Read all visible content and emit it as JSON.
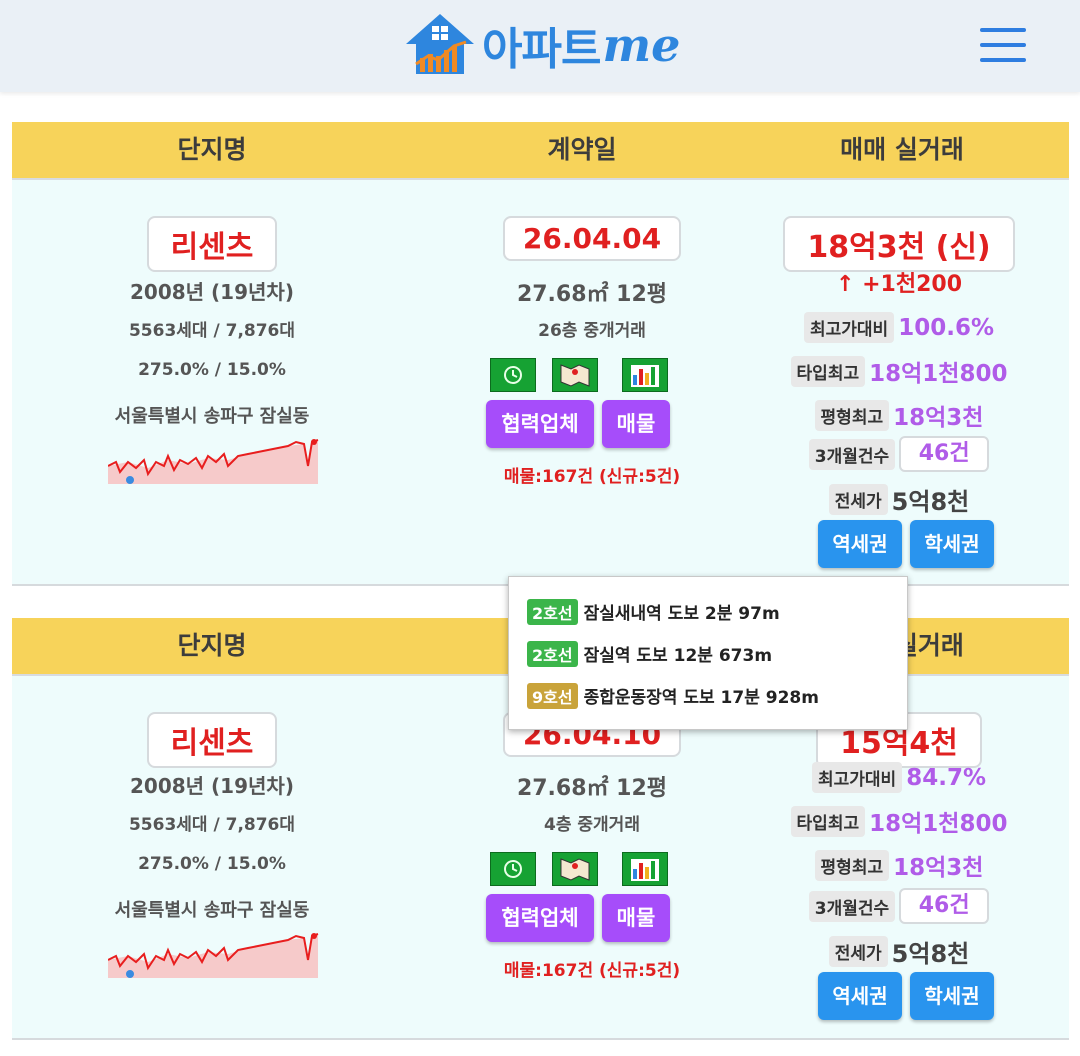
{
  "header": {
    "logo_text": "아파트",
    "logo_suffix": "me"
  },
  "columns": {
    "name": "단지명",
    "date": "계약일",
    "price": "매매 실거래"
  },
  "cards": [
    {
      "name": "리센츠",
      "year": "2008년 (19년차)",
      "households": "5563세대 / 7,876대",
      "ratio": "275.0% / 15.0%",
      "address": "서울특별시 송파구 잠실동",
      "date": "26.04.04",
      "area": "27.68㎡ 12평",
      "floor": "26층 중개거래",
      "btn_partner": "협력업체",
      "btn_listing": "매물",
      "listing_count": "매물:167건 (신규:5건)",
      "price": "18억3천 (신)",
      "change": "↑ +1천200",
      "max_ratio_label": "최고가대비",
      "max_ratio": "100.6%",
      "type_max_label": "타입최고",
      "type_max": "18억1천800",
      "py_max_label": "평형최고",
      "py_max": "18억3천",
      "count_label": "3개월건수",
      "count": "46건",
      "jeonse_label": "전세가",
      "jeonse": "5억8천",
      "btn_station": "역세권",
      "btn_school": "학세권"
    },
    {
      "name": "리센츠",
      "year": "2008년 (19년차)",
      "households": "5563세대 / 7,876대",
      "ratio": "275.0% / 15.0%",
      "address": "서울특별시 송파구 잠실동",
      "date": "26.04.10",
      "area": "27.68㎡ 12평",
      "floor": "4층 중개거래",
      "btn_partner": "협력업체",
      "btn_listing": "매물",
      "listing_count": "매물:167건 (신규:5건)",
      "price": "15억4천",
      "max_ratio_label": "최고가대비",
      "max_ratio": "84.7%",
      "type_max_label": "타입최고",
      "type_max": "18억1천800",
      "py_max_label": "평형최고",
      "py_max": "18억3천",
      "count_label": "3개월건수",
      "count": "46건",
      "jeonse_label": "전세가",
      "jeonse": "5억8천",
      "btn_station": "역세권",
      "btn_school": "학세권"
    }
  ],
  "popup": {
    "stations": [
      {
        "line": "2호선",
        "line_color": "#3bb54a",
        "text": "잠실새내역  도보 2분  97m"
      },
      {
        "line": "2호선",
        "line_color": "#3bb54a",
        "text": "잠실역  도보 12분  673m"
      },
      {
        "line": "9호선",
        "line_color": "#c9a33a",
        "text": "종합운동장역  도보 17분  928m"
      }
    ]
  },
  "colors": {
    "header_bg": "#eaf0f6",
    "bar_bg": "#f7d35a",
    "card_bg": "#eefcfc",
    "accent_red": "#e02020",
    "purple": "#a64dfa",
    "blue": "#2994ee"
  }
}
